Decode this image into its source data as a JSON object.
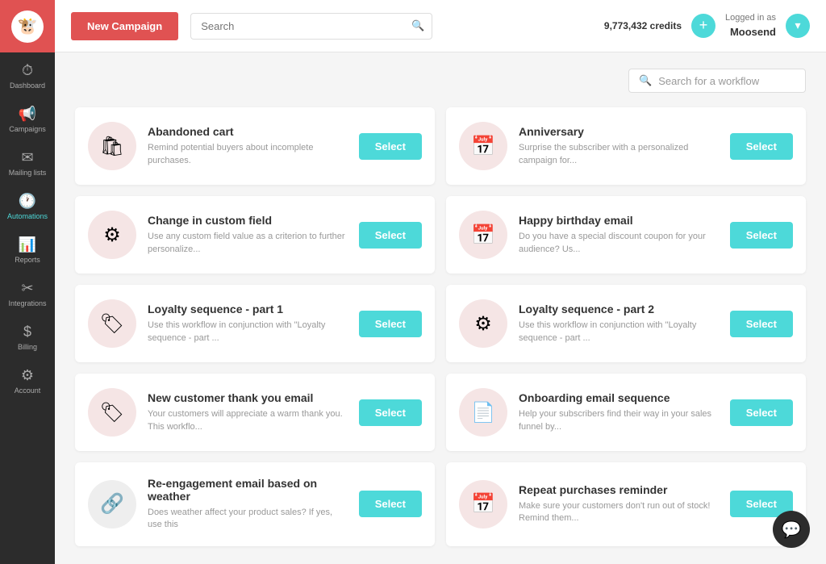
{
  "sidebar": {
    "logo": "🐮",
    "items": [
      {
        "id": "dashboard",
        "label": "Dashboard",
        "icon": "⏱",
        "active": false
      },
      {
        "id": "campaigns",
        "label": "Campaigns",
        "icon": "📢",
        "active": false
      },
      {
        "id": "mailing-lists",
        "label": "Mailing lists",
        "icon": "✉",
        "active": false
      },
      {
        "id": "automations",
        "label": "Automations",
        "icon": "🕐",
        "active": true
      },
      {
        "id": "reports",
        "label": "Reports",
        "icon": "📊",
        "active": false
      },
      {
        "id": "integrations",
        "label": "Integrations",
        "icon": "✂",
        "active": false
      },
      {
        "id": "billing",
        "label": "Billing",
        "icon": "$",
        "active": false
      },
      {
        "id": "account",
        "label": "Account",
        "icon": "⚙",
        "active": false
      }
    ]
  },
  "header": {
    "new_campaign_label": "New Campaign",
    "search_placeholder": "Search",
    "credits_label": "credits",
    "credits_value": "9,773,432",
    "logged_in_as": "Logged in as",
    "username": "Moosend"
  },
  "content": {
    "workflow_search_placeholder": "Search for a workflow",
    "workflows": [
      {
        "id": "abandoned-cart",
        "title": "Abandoned cart",
        "description": "Remind potential buyers about incomplete purchases.",
        "icon": "🛍",
        "select_label": "Select"
      },
      {
        "id": "anniversary",
        "title": "Anniversary",
        "description": "Surprise the subscriber with a personalized campaign for...",
        "icon": "📅",
        "select_label": "Select"
      },
      {
        "id": "change-custom-field",
        "title": "Change in custom field",
        "description": "Use any custom field value as a criterion to further personalize...",
        "icon": "🔧",
        "select_label": "Select"
      },
      {
        "id": "happy-birthday",
        "title": "Happy birthday email",
        "description": "Do you have a special discount coupon for your audience? Us...",
        "icon": "📅",
        "select_label": "Select"
      },
      {
        "id": "loyalty-1",
        "title": "Loyalty sequence - part 1",
        "description": "Use this workflow in conjunction with \"Loyalty sequence - part ...",
        "icon": "🏷",
        "select_label": "Select"
      },
      {
        "id": "loyalty-2",
        "title": "Loyalty sequence - part 2",
        "description": "Use this workflow in conjunction with \"Loyalty sequence - part ...",
        "icon": "🔧",
        "select_label": "Select"
      },
      {
        "id": "new-customer",
        "title": "New customer thank you email",
        "description": "Your customers will appreciate a warm thank you. This workflo...",
        "icon": "🏷",
        "select_label": "Select"
      },
      {
        "id": "onboarding",
        "title": "Onboarding email sequence",
        "description": "Help your subscribers find their way in your sales funnel by...",
        "icon": "🏷",
        "select_label": "Select"
      },
      {
        "id": "reengagement",
        "title": "Re-engagement email based on weather",
        "description": "Does weather affect your product sales? If yes, use this",
        "icon": "🔗",
        "select_label": "Select"
      },
      {
        "id": "repeat-purchases",
        "title": "Repeat purchases reminder",
        "description": "Make sure your customers don't run out of stock! Remind them...",
        "icon": "📅",
        "select_label": "Select"
      }
    ]
  }
}
